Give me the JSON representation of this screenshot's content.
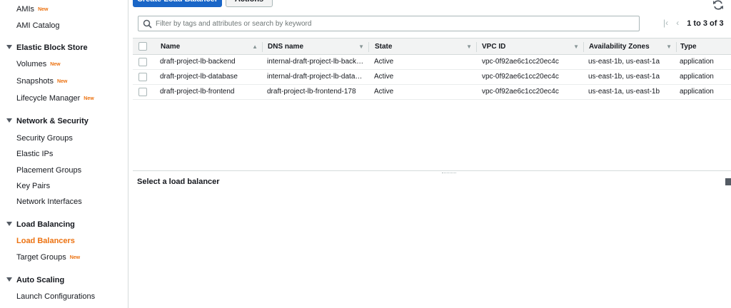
{
  "sidebar": {
    "items": [
      {
        "label": "AMIs",
        "badge": "New",
        "type": "item",
        "active": false
      },
      {
        "label": "AMI Catalog",
        "badge": "",
        "type": "item",
        "active": false
      },
      {
        "label": "Elastic Block Store",
        "type": "section"
      },
      {
        "label": "Volumes",
        "badge": "New",
        "type": "item",
        "active": false
      },
      {
        "label": "Snapshots",
        "badge": "New",
        "type": "item",
        "active": false
      },
      {
        "label": "Lifecycle Manager",
        "badge": "New",
        "type": "item",
        "active": false
      },
      {
        "label": "Network & Security",
        "type": "section"
      },
      {
        "label": "Security Groups",
        "badge": "",
        "type": "item",
        "active": false
      },
      {
        "label": "Elastic IPs",
        "badge": "",
        "type": "item",
        "active": false
      },
      {
        "label": "Placement Groups",
        "badge": "",
        "type": "item",
        "active": false
      },
      {
        "label": "Key Pairs",
        "badge": "",
        "type": "item",
        "active": false
      },
      {
        "label": "Network Interfaces",
        "badge": "",
        "type": "item",
        "active": false
      },
      {
        "label": "Load Balancing",
        "type": "section"
      },
      {
        "label": "Load Balancers",
        "badge": "",
        "type": "item",
        "active": true
      },
      {
        "label": "Target Groups",
        "badge": "New",
        "type": "item",
        "active": false
      },
      {
        "label": "Auto Scaling",
        "type": "section"
      },
      {
        "label": "Launch Configurations",
        "badge": "",
        "type": "item",
        "active": false
      }
    ]
  },
  "toolbar": {
    "create_label": "Create Load Balancer",
    "actions_label": "Actions",
    "refresh_icon": "refresh-icon"
  },
  "search": {
    "placeholder": "Filter by tags and attributes or search by keyword",
    "value": ""
  },
  "pager": {
    "range": "1 to 3 of 3"
  },
  "table": {
    "columns": [
      "Name",
      "DNS name",
      "State",
      "VPC ID",
      "Availability Zones",
      "Type"
    ],
    "rows": [
      [
        "draft-project-lb-backend",
        "internal-draft-project-lb-backend",
        "Active",
        "vpc-0f92ae6c1cc20ec4c",
        "us-east-1b, us-east-1a",
        "application"
      ],
      [
        "draft-project-lb-database",
        "internal-draft-project-lb-database",
        "Active",
        "vpc-0f92ae6c1cc20ec4c",
        "us-east-1b, us-east-1a",
        "application"
      ],
      [
        "draft-project-lb-frontend",
        "draft-project-lb-frontend-178",
        "Active",
        "vpc-0f92ae6c1cc20ec4c",
        "us-east-1a, us-east-1b",
        "application"
      ]
    ]
  },
  "details": {
    "title": "Select a load balancer"
  },
  "colors": {
    "accent": "#ec7211",
    "primary_button": "#1a66c7"
  }
}
